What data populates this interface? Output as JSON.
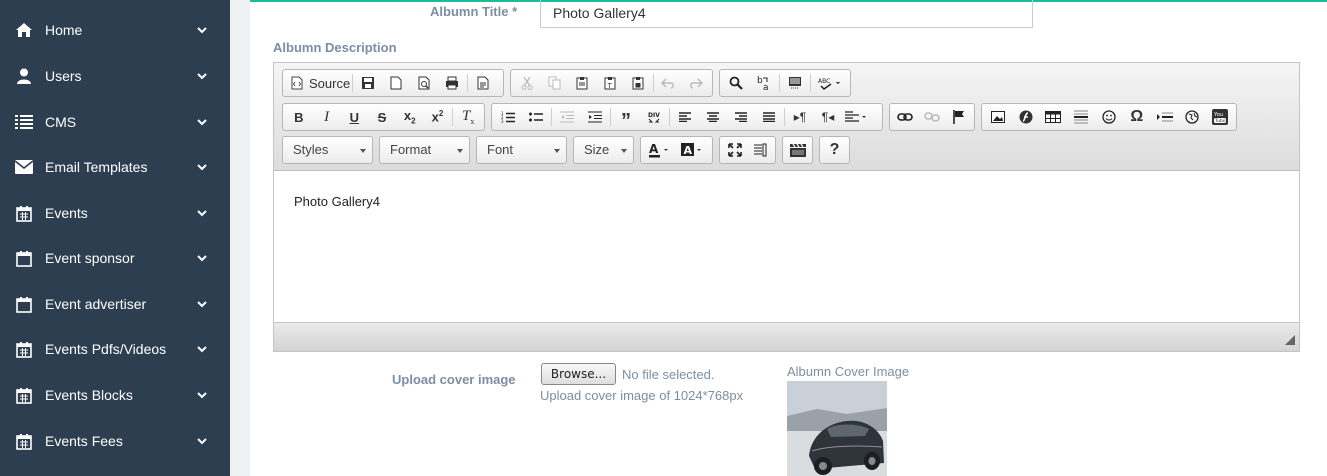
{
  "sidebar": {
    "items": [
      {
        "label": "Home",
        "icon": "home-icon"
      },
      {
        "label": "Users",
        "icon": "user-icon"
      },
      {
        "label": "CMS",
        "icon": "list-icon"
      },
      {
        "label": "Email Templates",
        "icon": "envelope-icon"
      },
      {
        "label": "Events",
        "icon": "calendar-icon"
      },
      {
        "label": "Event sponsor",
        "icon": "calendar-icon"
      },
      {
        "label": "Event advertiser",
        "icon": "calendar-icon"
      },
      {
        "label": "Events Pdfs/Videos",
        "icon": "calendar-icon"
      },
      {
        "label": "Events Blocks",
        "icon": "calendar-icon"
      },
      {
        "label": "Events Fees",
        "icon": "calendar-icon"
      }
    ]
  },
  "form": {
    "title_label": "Albumn Title *",
    "title_value": "Photo Gallery4",
    "description_label": "Albumn Description",
    "upload_label": "Upload cover image",
    "browse_label": "Browse...",
    "no_file_text": "No file selected.",
    "upload_hint": "Upload cover image of 1024*768px",
    "cover_label": "Albumn Cover Image"
  },
  "editor": {
    "source_label": "Source",
    "content": "Photo Gallery4",
    "combos": {
      "styles": "Styles",
      "format": "Format",
      "font": "Font",
      "size": "Size"
    },
    "help_label": "?"
  },
  "colors": {
    "sidebar_bg": "#2c3e50",
    "accent": "#1abc9c",
    "label_color": "#7d8ea3"
  }
}
